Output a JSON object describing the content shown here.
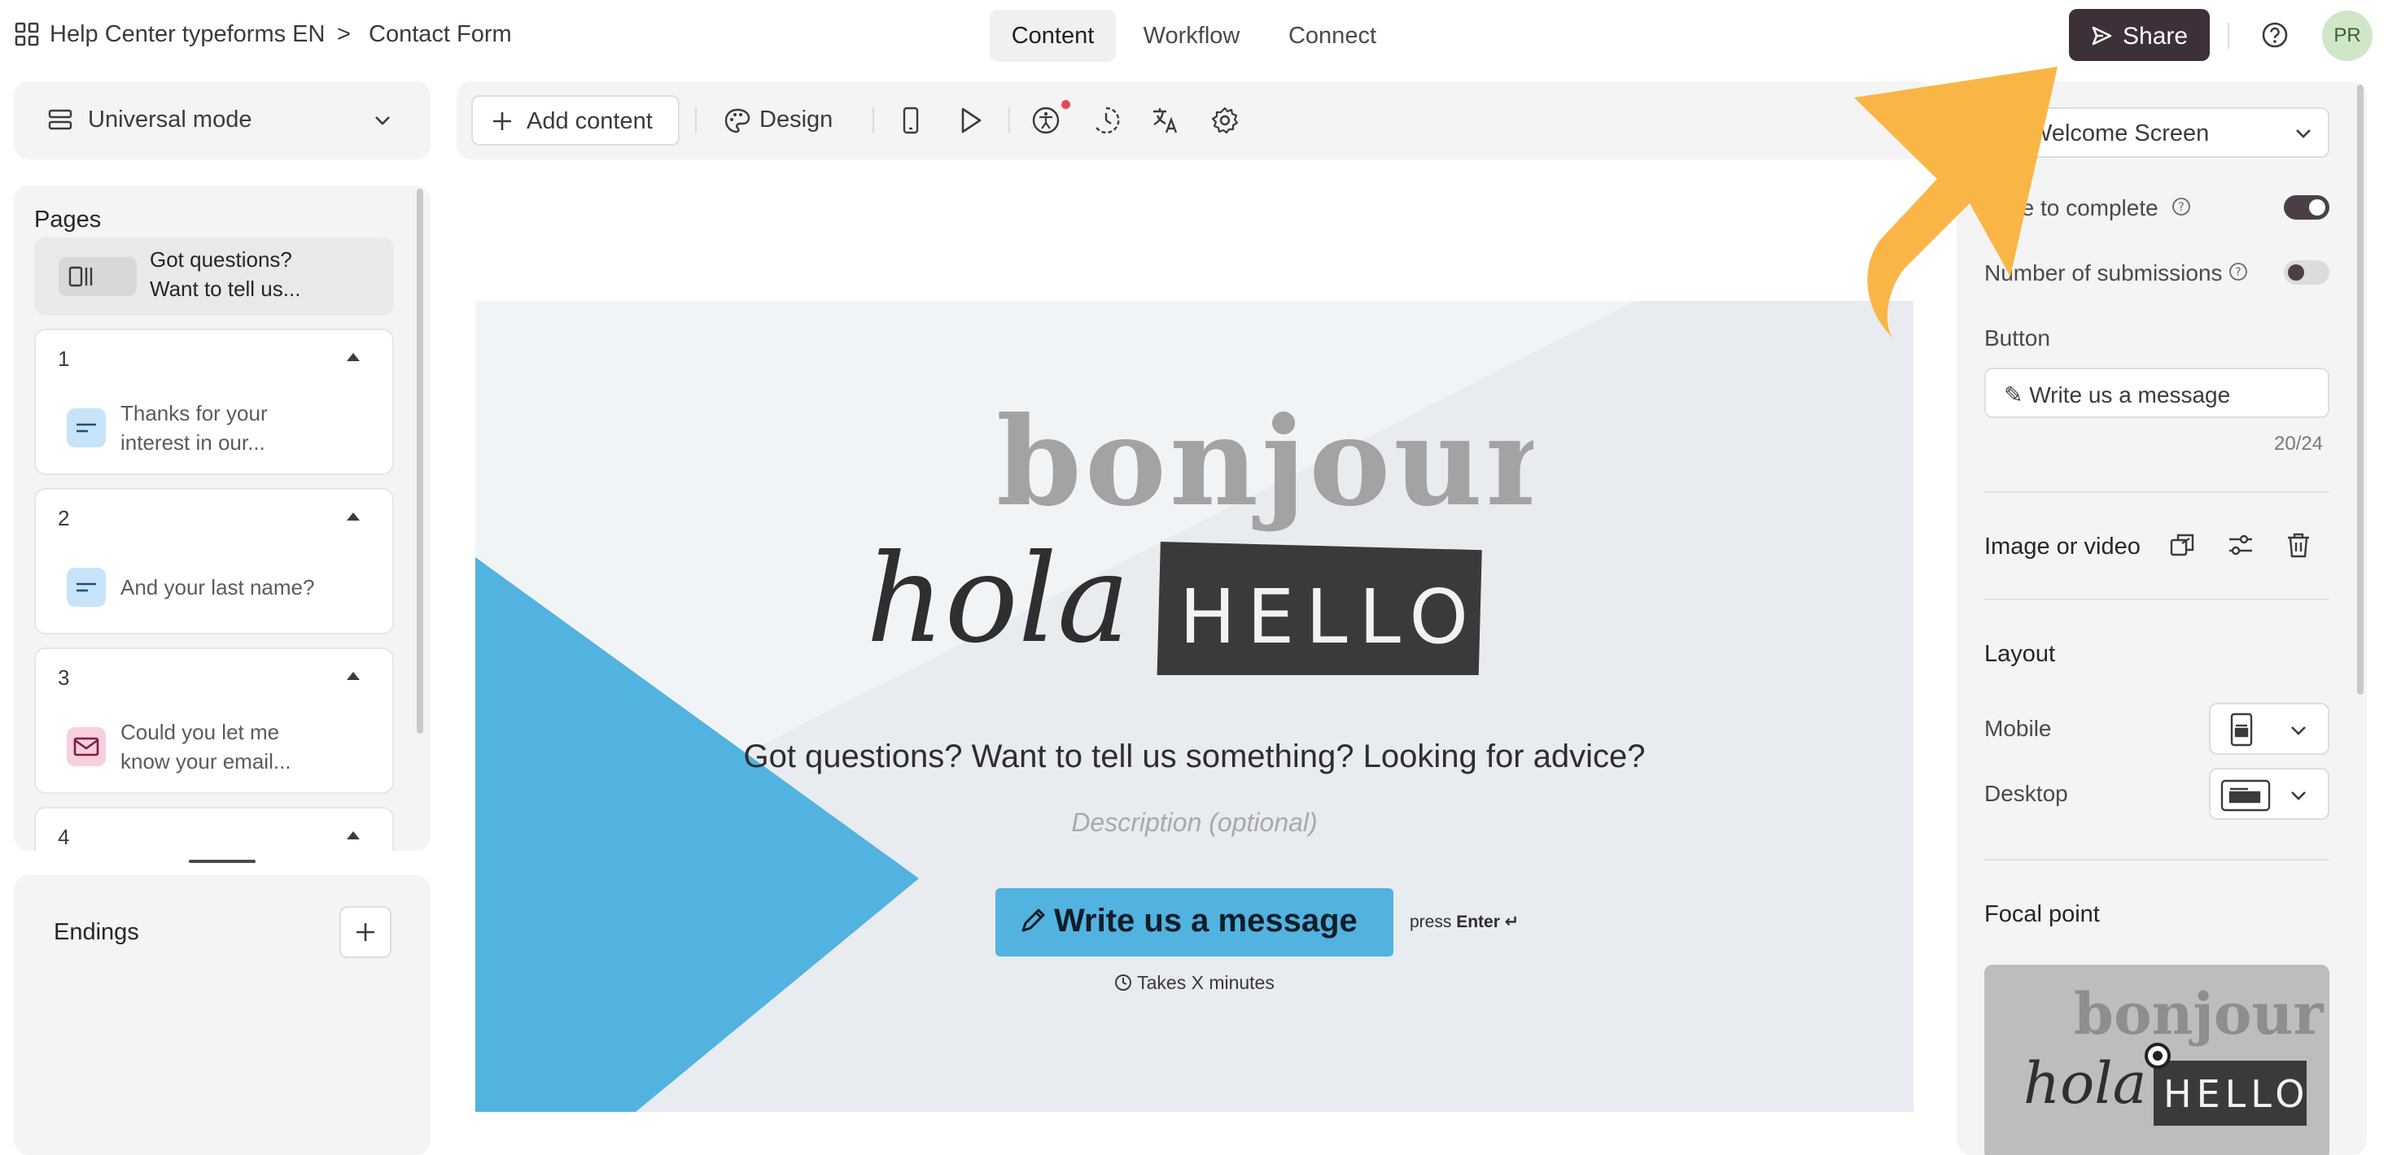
{
  "header": {
    "breadcrumb_workspace": "Help Center typeforms EN",
    "breadcrumb_sep": ">",
    "breadcrumb_form": "Contact Form",
    "tabs": [
      {
        "label": "Content",
        "active": true
      },
      {
        "label": "Workflow",
        "active": false
      },
      {
        "label": "Connect",
        "active": false
      }
    ],
    "share_label": "Share",
    "avatar_initials": "PR"
  },
  "left": {
    "mode_label": "Universal mode",
    "pages_title": "Pages",
    "welcome_page": {
      "text_line1": "Got questions?",
      "text_line2": "Want to tell us..."
    },
    "pages": [
      {
        "num": "1",
        "line1": "Thanks for your",
        "line2": "interest in our...",
        "icon": "short-text-icon",
        "color": "#c7e3fa"
      },
      {
        "num": "2",
        "line1": "And your last name?",
        "line2": "",
        "icon": "short-text-icon",
        "color": "#c7e3fa"
      },
      {
        "num": "3",
        "line1": "Could you let me",
        "line2": "know your email...",
        "icon": "email-icon",
        "color": "#f7cfdd"
      },
      {
        "num": "4",
        "line1": "",
        "line2": "",
        "icon": "",
        "color": ""
      }
    ],
    "endings_title": "Endings"
  },
  "toolbar": {
    "add_content_label": "Add content",
    "design_label": "Design"
  },
  "canvas": {
    "headline": "Got questions? Want to tell us something? Looking for advice?",
    "description_placeholder": "Description (optional)",
    "cta_label": "Write us a message",
    "press_text": "press",
    "press_key": "Enter ↵",
    "takes_text": "Takes X minutes",
    "hero_word1": "bonjour",
    "hero_word2": "hola",
    "hero_word3": "HELLO",
    "accent_color": "#52b2e0"
  },
  "right": {
    "screen_select": "Welcome Screen",
    "time_to_complete_label": "Time to complete",
    "time_to_complete_on": true,
    "submissions_label": "Number of submissions",
    "submissions_on": false,
    "button_label": "Button",
    "button_value": "✎ Write us a message",
    "button_count": "20/24",
    "image_label": "Image or video",
    "layout_title": "Layout",
    "mobile_label": "Mobile",
    "desktop_label": "Desktop",
    "focal_title": "Focal point",
    "focal_word1": "bonjour",
    "focal_word2": "hola",
    "focal_word3": "HELLO"
  },
  "colors": {
    "share_button": "#3d3039",
    "annotation_arrow": "#f9b646",
    "canvas_bg": "#e8ebef"
  }
}
